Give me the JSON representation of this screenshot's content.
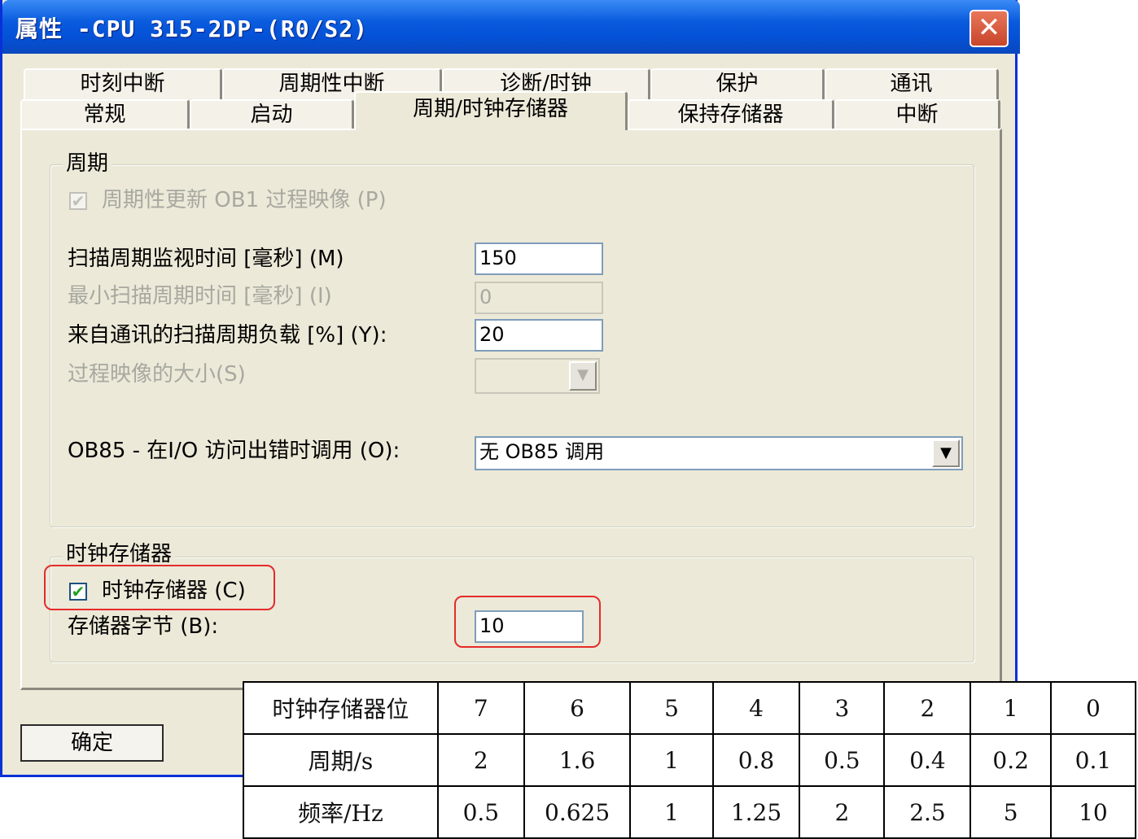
{
  "window": {
    "title": "属性 -CPU 315-2DP-(R0/S2)",
    "close_icon": "✕"
  },
  "tabs": {
    "row_back": [
      "时刻中断",
      "周期性中断",
      "诊断/时钟",
      "保护",
      "通讯"
    ],
    "row_front": [
      "常规",
      "启动",
      "周期/时钟存储器",
      "保持存储器",
      "中断"
    ],
    "active": "周期/时钟存储器"
  },
  "cycle": {
    "legend": "周期",
    "update_ob1_label": "周期性更新 OB1 过程映像 (P)",
    "update_ob1_checked": true,
    "scan_monitor_label": "扫描周期监视时间 [毫秒] (M)",
    "scan_monitor_value": "150",
    "min_scan_label": "最小扫描周期时间 [毫秒] (I)",
    "min_scan_value": "0",
    "comm_load_label": "来自通讯的扫描周期负载 [%] (Y):",
    "comm_load_value": "20",
    "process_image_label": "过程映像的大小(S)",
    "process_image_value": "",
    "ob85_label": "OB85 - 在I/O 访问出错时调用 (O):",
    "ob85_value": "无 OB85 调用"
  },
  "clock_memory": {
    "legend": "时钟存储器",
    "enable_label": "时钟存储器 (C)",
    "enable_checked": true,
    "byte_label": "存储器字节 (B):",
    "byte_value": "10"
  },
  "buttons": {
    "ok": "确定"
  },
  "clock_table": {
    "rows": [
      [
        "时钟存储器位",
        "7",
        "6",
        "5",
        "4",
        "3",
        "2",
        "1",
        "0"
      ],
      [
        "周期/s",
        "2",
        "1.6",
        "1",
        "0.8",
        "0.5",
        "0.4",
        "0.2",
        "0.1"
      ],
      [
        "频率/Hz",
        "0.5",
        "0.625",
        "1",
        "1.25",
        "2",
        "2.5",
        "5",
        "10"
      ]
    ]
  },
  "icons": {
    "check": "✔",
    "dropdown": "▼"
  },
  "colors": {
    "titlebar": "#0a5bde",
    "dialog_bg": "#ece9d8",
    "highlight": "#e52b2b"
  }
}
